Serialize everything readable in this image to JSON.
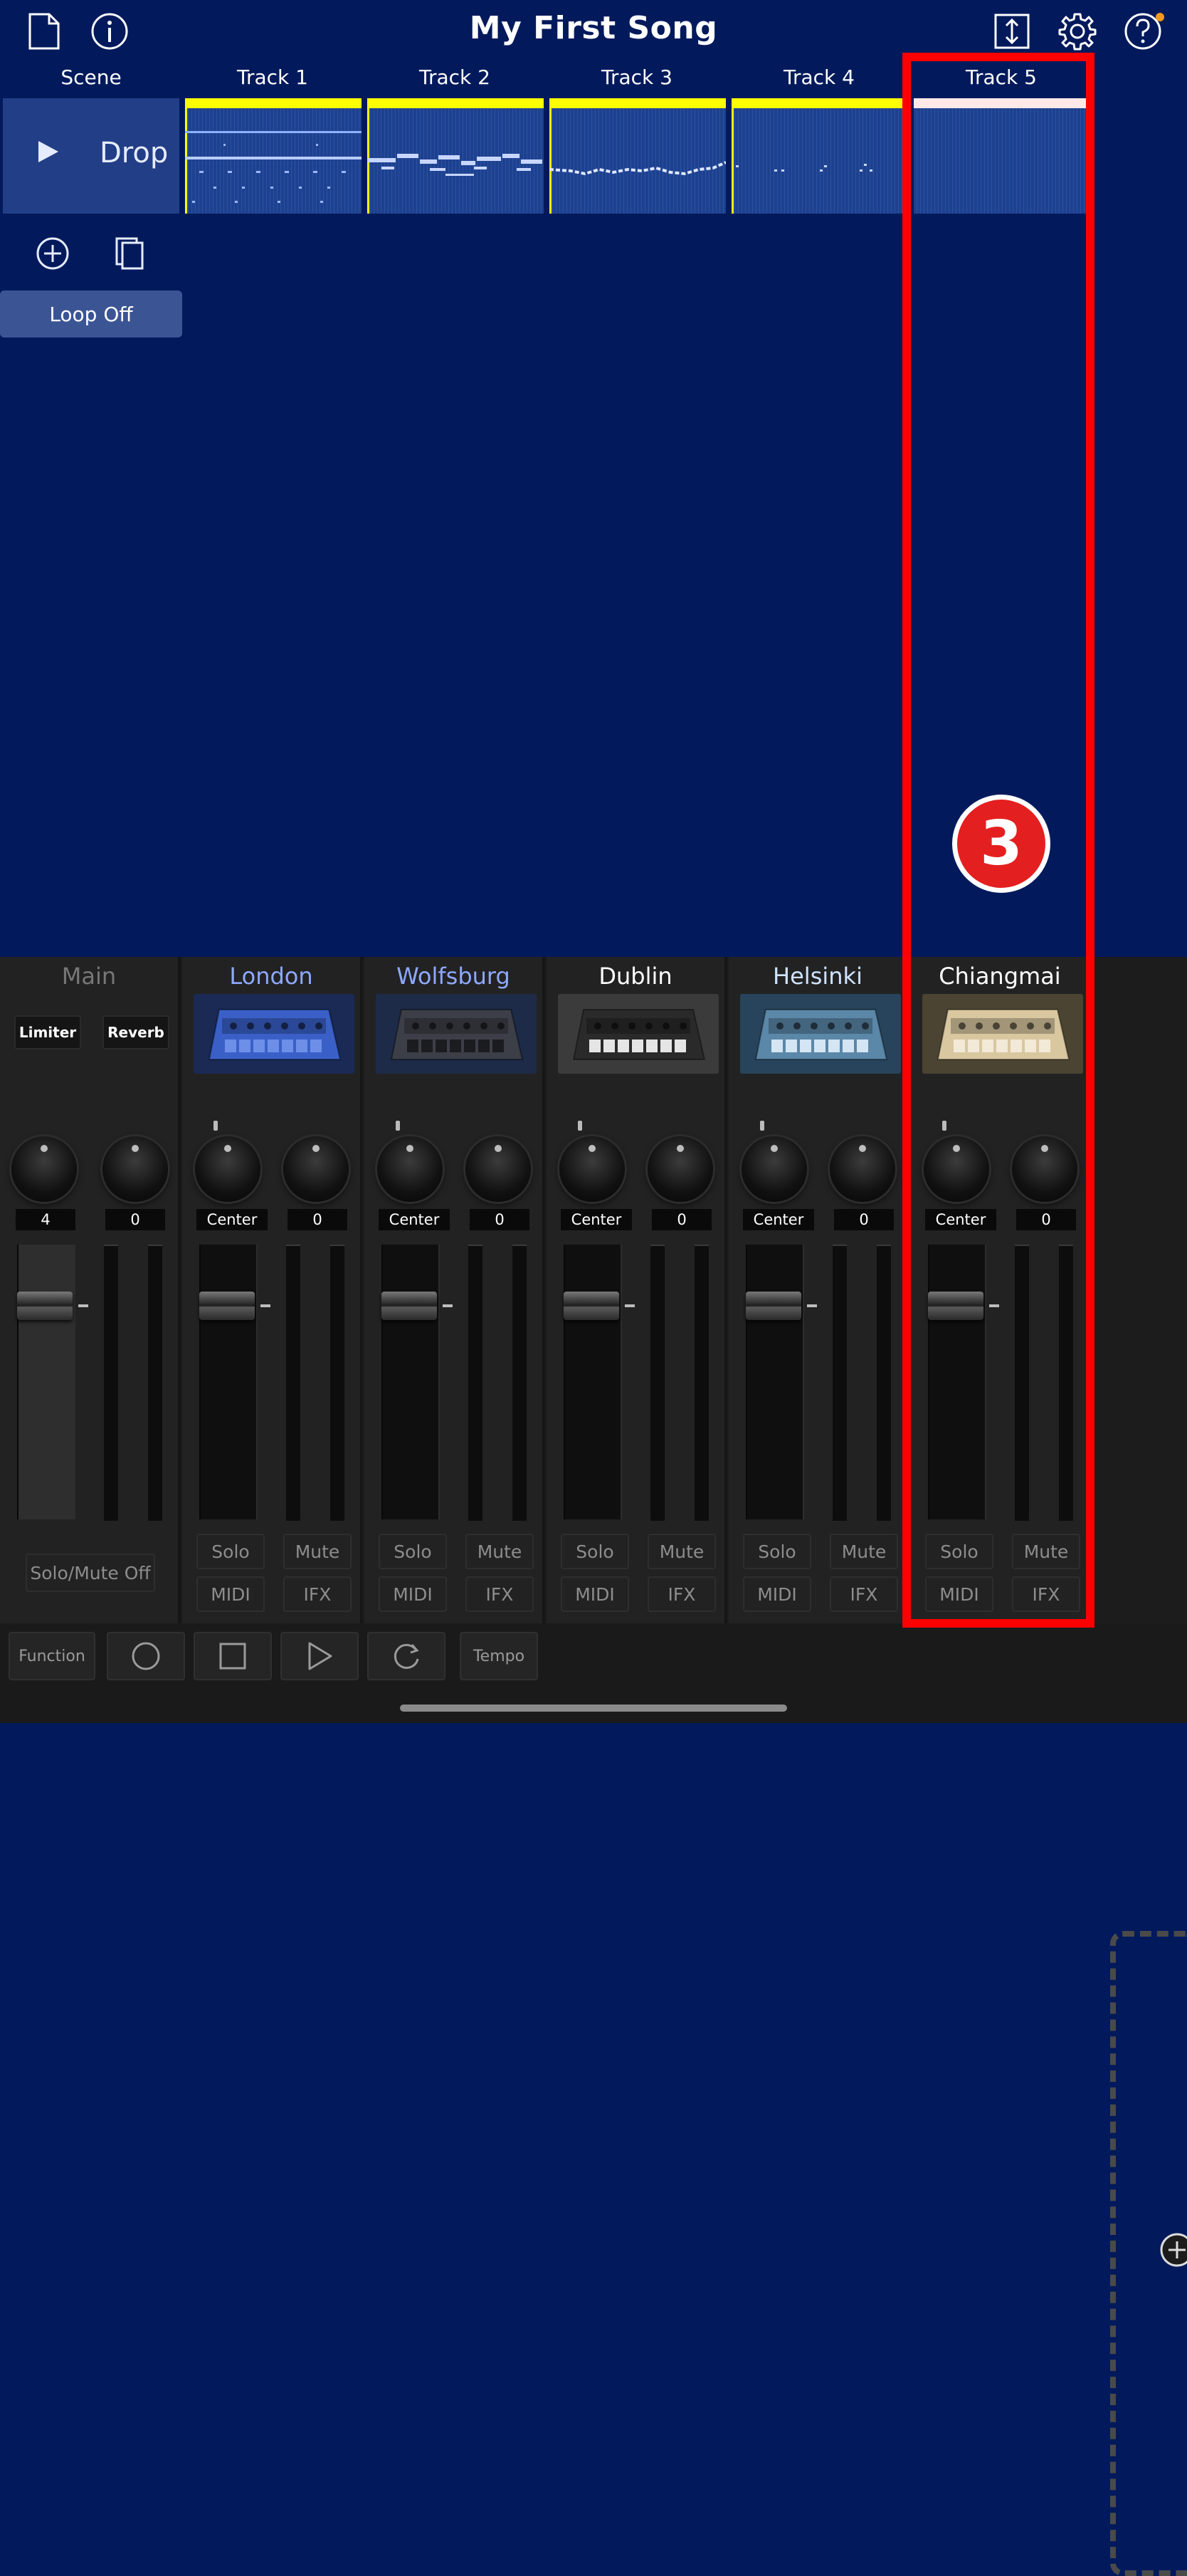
{
  "header": {
    "title": "My First Song",
    "icons": [
      "new-document-icon",
      "info-icon",
      "import-export-icon",
      "settings-gear-icon",
      "help-icon"
    ]
  },
  "columns": {
    "scene_label": "Scene",
    "tracks": [
      "Track 1",
      "Track 2",
      "Track 3",
      "Track 4",
      "Track 5"
    ]
  },
  "scene": {
    "name": "Drop",
    "loop_label": "Loop Off"
  },
  "colors": {
    "background": "#021a5c",
    "clip_active_bar": "#ffff00",
    "clip_empty_bar": "#ffe8e8",
    "highlight": "#ff0000"
  },
  "mixer": {
    "main": {
      "name": "Main",
      "fx1": "Limiter",
      "fx2": "Reverb",
      "knob1_value": "4",
      "knob2_value": "0",
      "solo_mute_label": "Solo/Mute Off"
    },
    "strips": [
      {
        "name": "London",
        "pan": "Center",
        "send": "0",
        "solo": "Solo",
        "mute": "Mute",
        "midi": "MIDI",
        "ifx": "IFX"
      },
      {
        "name": "Wolfsburg",
        "pan": "Center",
        "send": "0",
        "solo": "Solo",
        "mute": "Mute",
        "midi": "MIDI",
        "ifx": "IFX"
      },
      {
        "name": "Dublin",
        "pan": "Center",
        "send": "0",
        "solo": "Solo",
        "mute": "Mute",
        "midi": "MIDI",
        "ifx": "IFX"
      },
      {
        "name": "Helsinki",
        "pan": "Center",
        "send": "0",
        "solo": "Solo",
        "mute": "Mute",
        "midi": "MIDI",
        "ifx": "IFX"
      },
      {
        "name": "Chiangmai",
        "pan": "Center",
        "send": "0",
        "solo": "Solo",
        "mute": "Mute",
        "midi": "MIDI",
        "ifx": "IFX"
      }
    ],
    "strip_name_colors": [
      "#8ea8ff",
      "#8ea8ff",
      "#ffffff",
      "#cfe3ff",
      "#ffffff"
    ]
  },
  "transport": {
    "function_label": "Function",
    "tempo_label": "Tempo",
    "icons": [
      "record-icon",
      "stop-icon",
      "play-icon",
      "loop-icon"
    ]
  },
  "annotation": {
    "badge_number": "3"
  }
}
